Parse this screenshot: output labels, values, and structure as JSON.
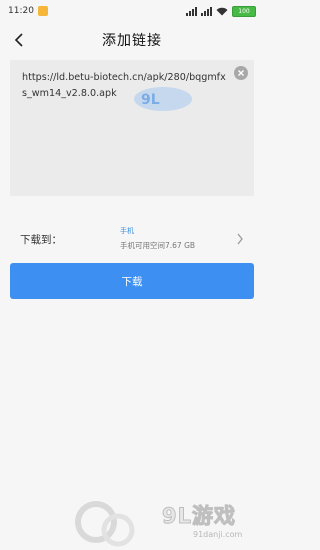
{
  "status_bar": {
    "time": "11:20",
    "battery": "100"
  },
  "header": {
    "title": "添加链接"
  },
  "link_input": {
    "value": "https://ld.betu-biotech.cn/apk/280/bqgmfxs_wm14_v2.8.0.apk"
  },
  "download_to": {
    "label": "下载到：",
    "storage_name": "手机",
    "storage_space": "手机可用空间7.67 GB"
  },
  "download_button": {
    "label": "下载"
  },
  "watermark": {
    "brand": "9L游戏",
    "site": "91danji.com"
  },
  "colors": {
    "accent": "#3d8ff1",
    "background": "#f6f6f6",
    "input_background": "#ebebeb"
  }
}
